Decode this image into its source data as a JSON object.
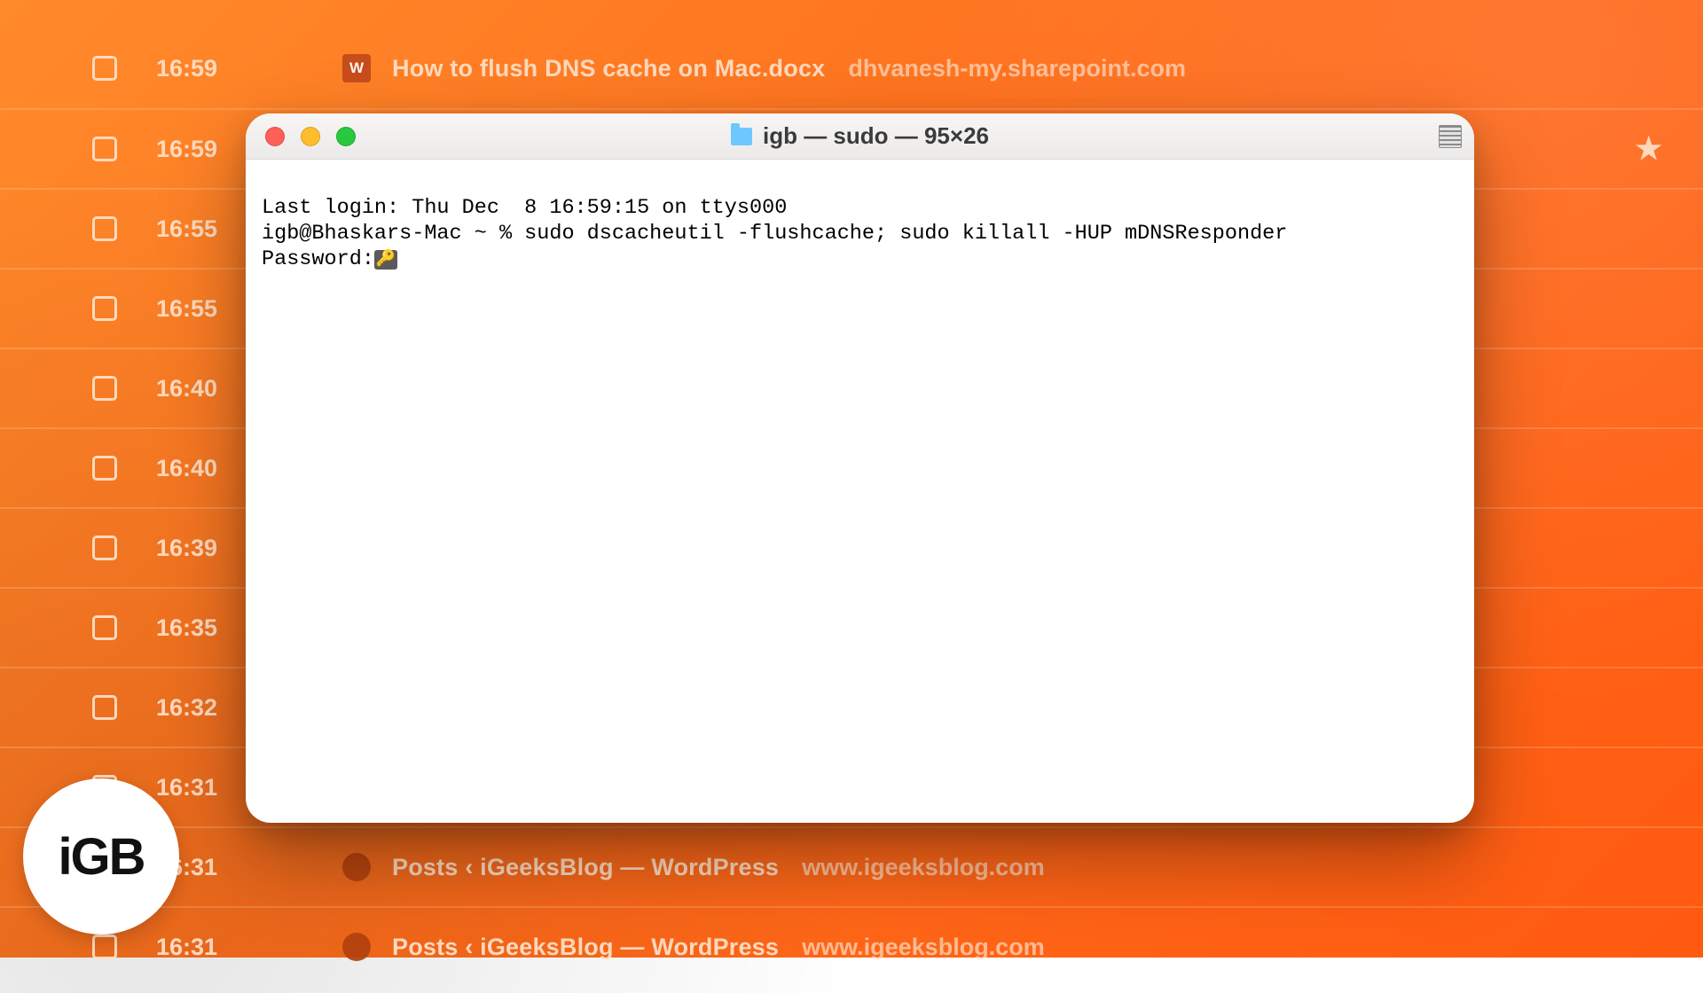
{
  "background_rows": [
    {
      "time": "16:59",
      "favicon_kind": "word",
      "favicon_text": "W",
      "title": "How to flush DNS cache on Mac.docx",
      "domain": "dhvanesh-my.sharepoint.com",
      "starred": false
    },
    {
      "time": "16:59",
      "favicon_kind": "",
      "favicon_text": "",
      "title": "",
      "domain": "",
      "starred": true
    },
    {
      "time": "16:55",
      "favicon_kind": "",
      "favicon_text": "",
      "title": "",
      "domain": "",
      "starred": false
    },
    {
      "time": "16:55",
      "favicon_kind": "",
      "favicon_text": "",
      "title": "",
      "domain": "",
      "starred": false
    },
    {
      "time": "16:40",
      "favicon_kind": "",
      "favicon_text": "",
      "title": "",
      "domain": "",
      "starred": false
    },
    {
      "time": "16:40",
      "favicon_kind": "",
      "favicon_text": "",
      "title": "",
      "domain": "",
      "starred": false
    },
    {
      "time": "16:39",
      "favicon_kind": "",
      "favicon_text": "",
      "title": "",
      "domain": "",
      "starred": false
    },
    {
      "time": "16:35",
      "favicon_kind": "",
      "favicon_text": "",
      "title": "",
      "domain": "",
      "starred": false
    },
    {
      "time": "16:32",
      "favicon_kind": "",
      "favicon_text": "",
      "title": "",
      "domain": "",
      "starred": false
    },
    {
      "time": "16:31",
      "favicon_kind": "",
      "favicon_text": "",
      "title": "",
      "domain": "",
      "starred": false
    },
    {
      "time": "16:31",
      "favicon_kind": "wp",
      "favicon_text": "",
      "title": "Posts ‹ iGeeksBlog — WordPress",
      "domain": "www.igeeksblog.com",
      "starred": false
    },
    {
      "time": "16:31",
      "favicon_kind": "wp",
      "favicon_text": "",
      "title": "Posts ‹ iGeeksBlog — WordPress",
      "domain": "www.igeeksblog.com",
      "starred": false
    }
  ],
  "badge": {
    "text": "iGB"
  },
  "terminal": {
    "window_title": "igb — sudo — 95×26",
    "line_login": "Last login: Thu Dec  8 16:59:15 on ttys000",
    "line_cmd": "igb@Bhaskars-Mac ~ % sudo dscacheutil -flushcache; sudo killall -HUP mDNSResponder",
    "line_pwd": "Password:",
    "key_icon_alt": "🔑"
  },
  "colors": {
    "bg_orange_start": "#ff8a2b",
    "bg_orange_end": "#ff5a10",
    "traffic_red": "#ff5f57",
    "traffic_yellow": "#ffbd2e",
    "traffic_green": "#28c840"
  }
}
